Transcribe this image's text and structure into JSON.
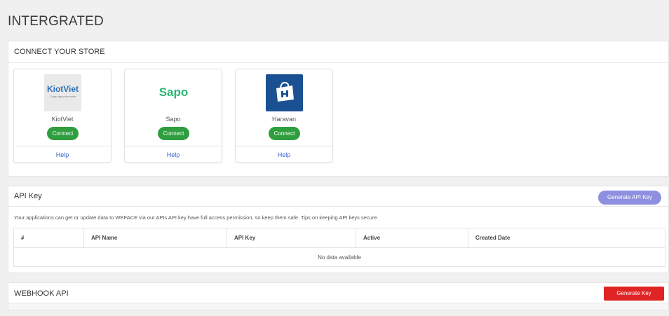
{
  "page": {
    "title": "INTERGRATED"
  },
  "store_section": {
    "title": "CONNECT YOUR STORE",
    "stores": [
      {
        "name": "KiotViet",
        "logo_text": "KiotViet",
        "logo_sub": "Cung cấp phần mềm",
        "connect_label": "Connect",
        "help_label": "Help"
      },
      {
        "name": "Sapo",
        "logo_text": "Sapo",
        "connect_label": "Connect",
        "help_label": "Help"
      },
      {
        "name": "Haravan",
        "connect_label": "Connect",
        "help_label": "Help"
      }
    ]
  },
  "api_section": {
    "title": "API Key",
    "generate_label": "Generate API Key",
    "description": "Your applications can get or update data to WEFACE via our APIs API key have full access permission, so keep them safe. Tips on keeping API keys secure.",
    "columns": [
      "#",
      "API Name",
      "API Key",
      "Active",
      "Created Date"
    ],
    "empty_text": "No data available"
  },
  "webhook_section": {
    "title": "WEBHOOK API",
    "generate_label": "Generate Key"
  },
  "colors": {
    "connect": "#2e9e3e",
    "api_button": "#8f8fe0",
    "webhook_button": "#e02424",
    "help_link": "#3a5fc7"
  }
}
